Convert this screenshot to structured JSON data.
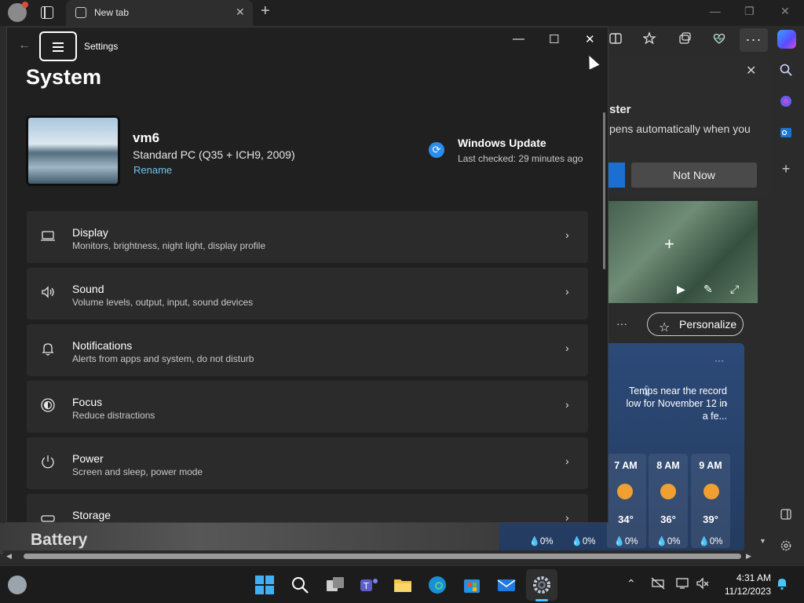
{
  "browser": {
    "tab_title": "New tab",
    "new_tab_symbol": "+",
    "tab_close_symbol": "✕",
    "window_controls": [
      "—",
      "❐",
      "✕"
    ],
    "more_symbol": "···",
    "panel": {
      "title": "ster",
      "text": "pens automatically when you",
      "not_now": "Not Now"
    },
    "feed": {
      "more_symbol": "···",
      "personalize_label": "Personalize"
    },
    "weather": {
      "more_symbol": "···",
      "alert": "Temps near the record low for November 12 in a fe...",
      "hours": [
        {
          "time": "7 AM",
          "temp": "34°",
          "precip": "0%"
        },
        {
          "time": "8 AM",
          "temp": "36°",
          "precip": "0%"
        },
        {
          "time": "9 AM",
          "temp": "39°",
          "precip": "0%"
        }
      ],
      "extra_precip": [
        "0%",
        "0%"
      ]
    },
    "behind_title": "Battery"
  },
  "settings": {
    "app_title": "Settings",
    "page_title": "System",
    "device": {
      "name": "vm6",
      "model": "Standard PC (Q35 + ICH9, 2009)",
      "rename_label": "Rename"
    },
    "windows_update": {
      "title": "Windows Update",
      "subtitle": "Last checked: 29 minutes ago"
    },
    "rows": [
      {
        "title": "Display",
        "subtitle": "Monitors, brightness, night light, display profile",
        "icon": "monitor-icon"
      },
      {
        "title": "Sound",
        "subtitle": "Volume levels, output, input, sound devices",
        "icon": "speaker-icon"
      },
      {
        "title": "Notifications",
        "subtitle": "Alerts from apps and system, do not disturb",
        "icon": "bell-icon"
      },
      {
        "title": "Focus",
        "subtitle": "Reduce distractions",
        "icon": "focus-icon"
      },
      {
        "title": "Power",
        "subtitle": "Screen and sleep, power mode",
        "icon": "power-icon"
      },
      {
        "title": "Storage",
        "subtitle": "",
        "icon": "storage-icon"
      }
    ]
  },
  "taskbar": {
    "time": "4:31 AM",
    "date": "11/12/2023"
  },
  "colors": {
    "accent": "#4cc2ff",
    "link": "#6cc6f0",
    "settings_bg": "#202020",
    "row_bg": "#2b2b2b"
  }
}
